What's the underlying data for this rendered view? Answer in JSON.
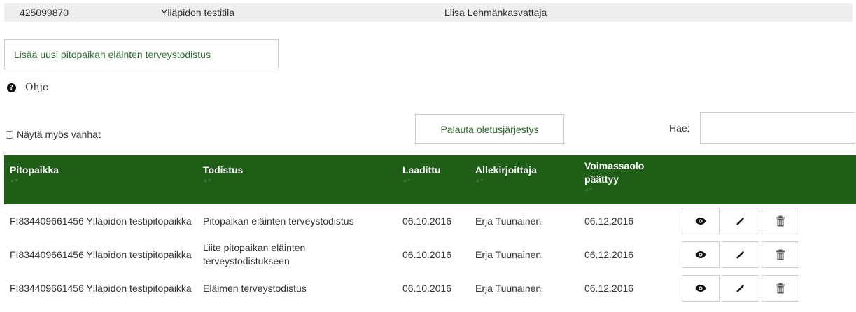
{
  "infobar": {
    "id": "425099870",
    "farm": "Ylläpidon testitila",
    "person": "Liisa Lehmänkasvattaja"
  },
  "add_button": "Lisää uusi pitopaikan eläinten terveystodistus",
  "help": {
    "icon": "question-circle-icon",
    "label": "Ohje"
  },
  "show_old": {
    "label": "Näytä myös vanhat",
    "checked": false
  },
  "reset_button": "Palauta oletusjärjestys",
  "search": {
    "label": "Hae:",
    "value": ""
  },
  "colors": {
    "header_bg": "#1e5e17",
    "button_text": "#2e6b2e",
    "infobar_bg": "#eeeeee"
  },
  "table": {
    "columns": [
      "Pitopaikka",
      "Todistus",
      "Laadittu",
      "Allekirjoittaja",
      "Voimassaolo päättyy"
    ],
    "sort_glyph": "▲▼",
    "rows": [
      {
        "pitopaikka": "FI834409661456 Ylläpidon testipitopaikka",
        "todistus": "Pitopaikan eläinten terveystodistus",
        "laadittu": "06.10.2016",
        "allekirjoittaja": "Erja Tuunainen",
        "paattyy": "06.12.2016"
      },
      {
        "pitopaikka": "FI834409661456 Ylläpidon testipitopaikka",
        "todistus": "Liite pitopaikan eläinten terveystodistukseen",
        "laadittu": "06.10.2016",
        "allekirjoittaja": "Erja Tuunainen",
        "paattyy": "06.12.2016"
      },
      {
        "pitopaikka": "FI834409661456 Ylläpidon testipitopaikka",
        "todistus": "Eläimen terveystodistus",
        "laadittu": "06.10.2016",
        "allekirjoittaja": "Erja Tuunainen",
        "paattyy": "06.12.2016"
      }
    ],
    "row_actions": [
      "eye-icon",
      "pencil-icon",
      "trash-icon"
    ]
  }
}
